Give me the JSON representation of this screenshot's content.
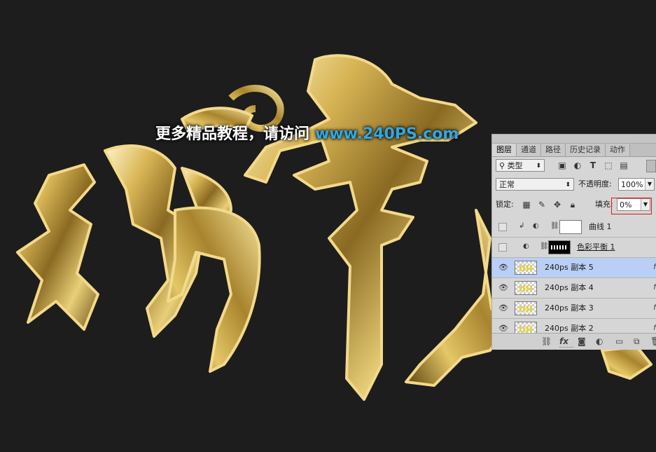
{
  "watermark": {
    "text_cn": "更多精品教程，请访问",
    "url": "www.240PS.com"
  },
  "colors": {
    "background": "#1d1d1d",
    "gold": "#c9a642",
    "watermark_url": "#2fa8e8",
    "selected_layer": "#b9cff5",
    "fill_highlight": "#e4141c"
  },
  "panel": {
    "tabs": [
      "图层",
      "通道",
      "路径",
      "历史记录",
      "动作"
    ],
    "active_tab": "图层",
    "filter_kind": "类型",
    "blend_mode": "正常",
    "opacity_label": "不透明度:",
    "opacity_value": "100%",
    "lock_label": "锁定:",
    "fill_label": "填充:",
    "fill_value": "0%",
    "layers": [
      {
        "name": "曲线 1",
        "visible": false,
        "type": "adjustment-curves",
        "selected": false
      },
      {
        "name": "色彩平衡 1",
        "visible": false,
        "type": "adjustment-color-balance",
        "selected": false
      },
      {
        "name": "240ps 副本 5",
        "visible": true,
        "type": "pixel",
        "selected": true,
        "fx": "f"
      },
      {
        "name": "240ps 副本 4",
        "visible": true,
        "type": "pixel",
        "selected": false,
        "fx": "f"
      },
      {
        "name": "240ps 副本 3",
        "visible": true,
        "type": "pixel",
        "selected": false,
        "fx": "f"
      },
      {
        "name": "240ps 副本 2",
        "visible": true,
        "type": "pixel",
        "selected": false,
        "fx": "f"
      }
    ],
    "bottom_icons": [
      "link-icon",
      "fx-icon",
      "mask-icon",
      "adjustment-icon",
      "folder-icon",
      "new-layer-icon",
      "trash-icon"
    ]
  }
}
